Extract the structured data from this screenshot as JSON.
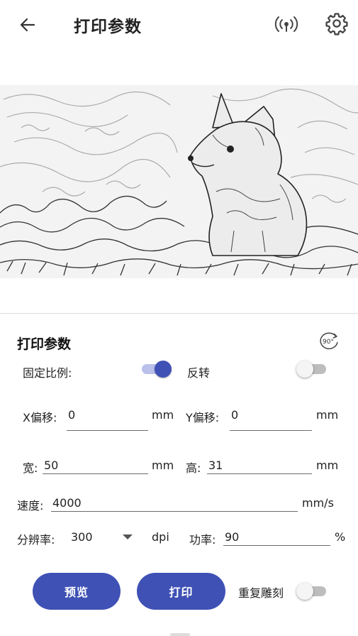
{
  "header": {
    "title": "打印参数"
  },
  "section": {
    "title": "打印参数",
    "rotate_label": "90°"
  },
  "fixed_ratio": {
    "label": "固定比例:",
    "on": true
  },
  "invert": {
    "label": "反转",
    "on": false
  },
  "x_offset": {
    "label": "X偏移:",
    "value": "0",
    "unit": "mm"
  },
  "y_offset": {
    "label": "Y偏移:",
    "value": "0",
    "unit": "mm"
  },
  "width": {
    "label": "宽:",
    "value": "50",
    "unit": "mm"
  },
  "height": {
    "label": "高:",
    "value": "31",
    "unit": "mm"
  },
  "speed": {
    "label": "速度:",
    "value": "4000",
    "unit": "mm/s"
  },
  "resolution": {
    "label": "分辨率:",
    "value": "300",
    "unit": "dpi"
  },
  "power": {
    "label": "功率:",
    "value": "90",
    "unit": "%"
  },
  "buttons": {
    "preview": "预览",
    "print": "打印"
  },
  "repeat_engrave": {
    "label": "重复雕刻",
    "on": false
  },
  "colors": {
    "accent": "#3f51b5",
    "switch_track_on": "#b9c0ea",
    "divider": "#dcdcdc"
  },
  "icons": {
    "back": "arrow-left-icon",
    "connection": "antenna-signal-icon",
    "settings": "gear-icon",
    "rotate": "rotate-90-icon"
  }
}
